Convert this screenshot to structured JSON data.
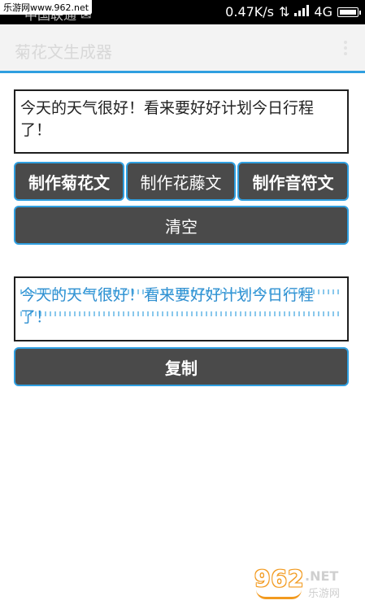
{
  "status_bar": {
    "left_text": "中国联通 ✉",
    "speed": "0.47K/s",
    "network": "4G",
    "signal_icon": "signal-icon",
    "battery_icon": "battery-icon"
  },
  "watermark_top": "乐游网www.962.net",
  "app_bar": {
    "title": "菊花文生成器",
    "overflow_icon": "overflow-menu-icon"
  },
  "input": {
    "value": "今天的天气很好！看来要好好计划今日行程了！"
  },
  "buttons": {
    "make_chrysanthemum": "制作菊花文",
    "make_vine": "制作花藤文",
    "make_music": "制作音符文",
    "clear": "清空",
    "copy": "复制"
  },
  "output": {
    "value": "今天的天气很好！看来要好好计划今日行程了！"
  },
  "watermark_logo": {
    "number": "962",
    "suffix": ".NET",
    "name": "乐游网"
  },
  "colors": {
    "accent": "#2f9fe0",
    "button_bg": "#4a4a4a",
    "logo_orange": "#f29a1f"
  }
}
